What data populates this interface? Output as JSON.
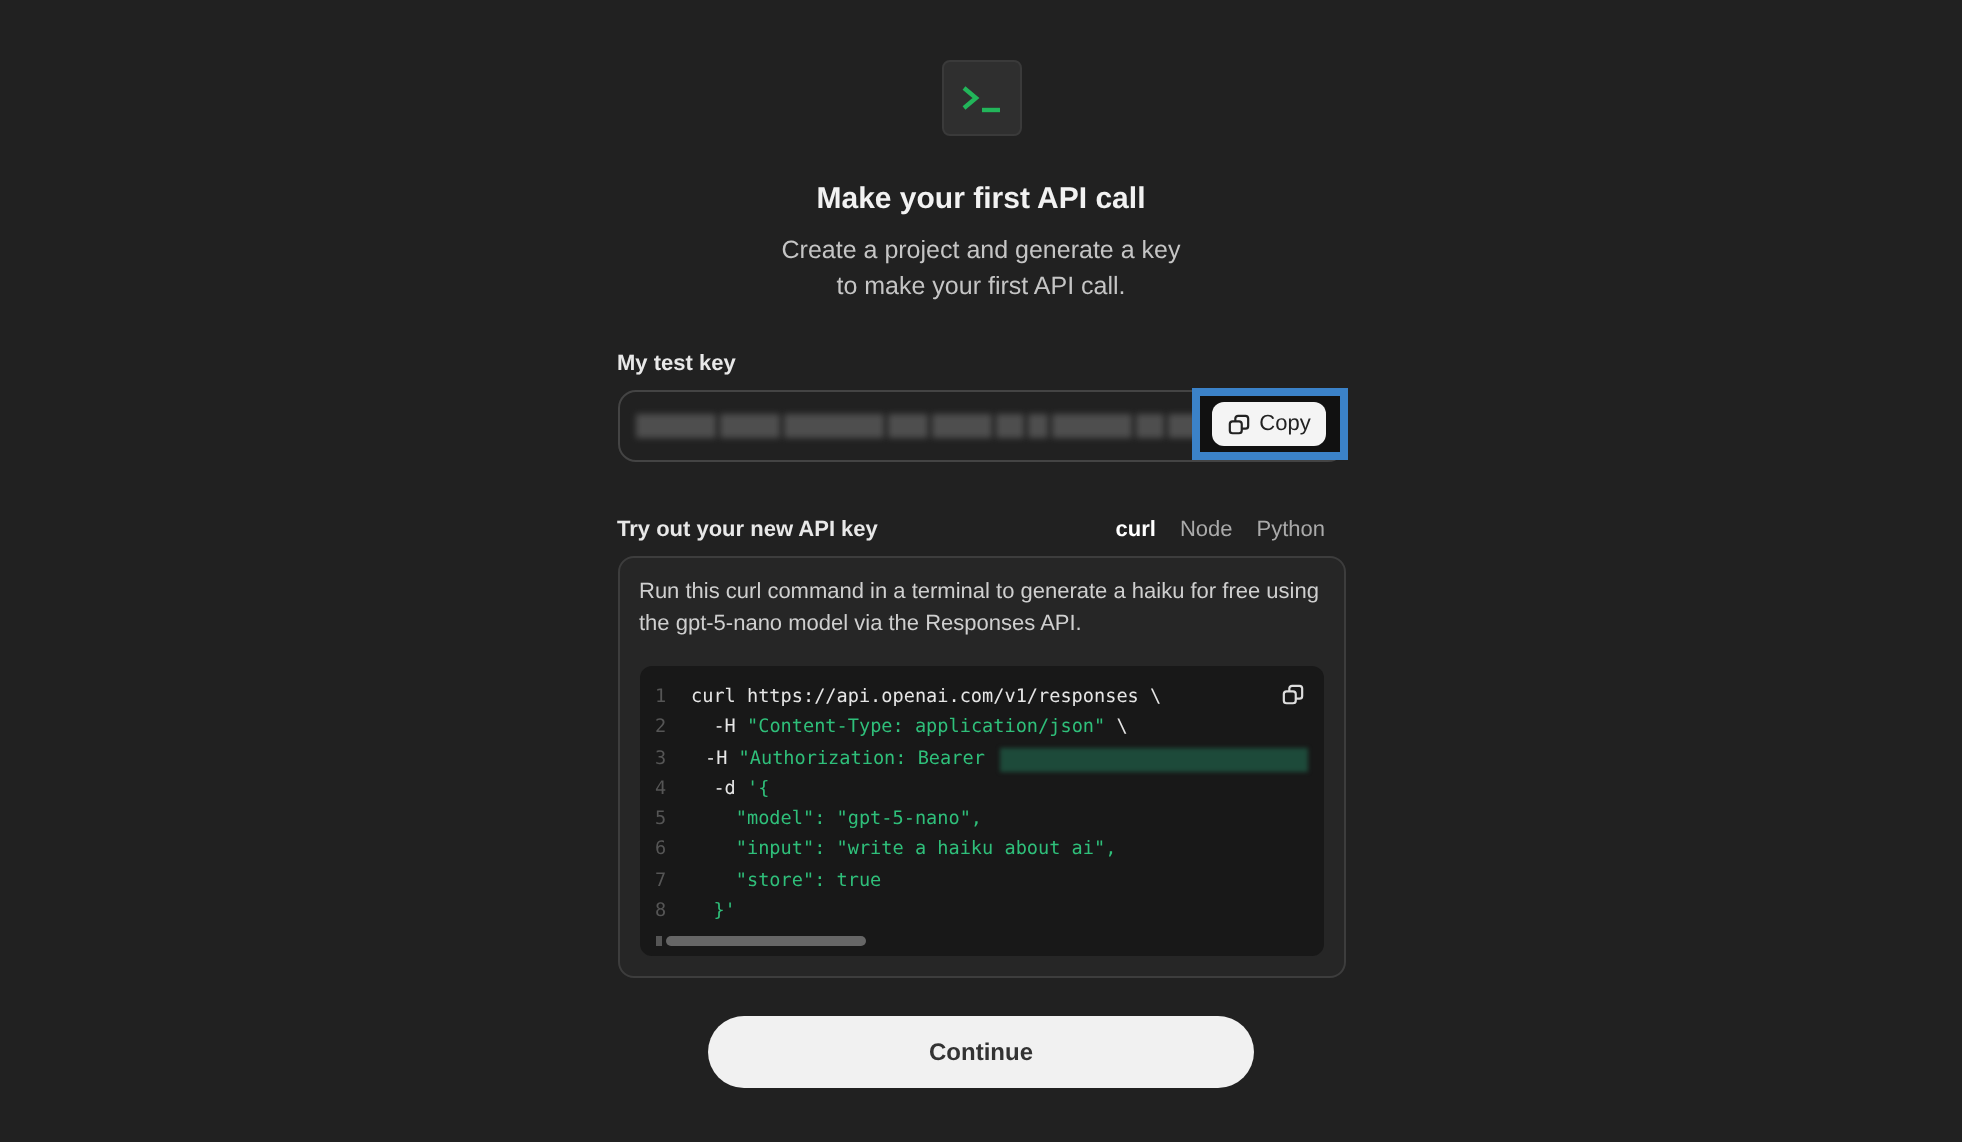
{
  "header": {
    "title": "Make your first API call",
    "subtitle": "Create a project and generate a key to make your first API call."
  },
  "key_section": {
    "label": "My test key",
    "field": {
      "kind": "masked"
    },
    "copy_button": {
      "label": "Copy",
      "highlighted": true
    }
  },
  "try_section": {
    "label": "Try out your new API key",
    "tabs": [
      {
        "label": "curl",
        "selected": true
      },
      {
        "label": "Node",
        "selected": false
      },
      {
        "label": "Python",
        "selected": false
      }
    ],
    "description": "Run this curl command in a terminal to generate a haiku for free using the gpt-5-nano model via the Responses API.",
    "code_lines": [
      {
        "number": "1",
        "tokens": [
          {
            "kind": "plain",
            "text": "curl https://api.openai.com/v1/responses \\"
          }
        ]
      },
      {
        "number": "2",
        "tokens": [
          {
            "kind": "plain",
            "text": "  -H "
          },
          {
            "kind": "string",
            "text": "\"Content-Type: application/json\""
          },
          {
            "kind": "plain",
            "text": " \\"
          }
        ]
      },
      {
        "number": "3",
        "tokens": [
          {
            "kind": "plain",
            "text": "  -H "
          },
          {
            "kind": "string",
            "text": "\"Authorization: Bearer"
          },
          {
            "kind": "masked"
          }
        ]
      },
      {
        "number": "4",
        "tokens": [
          {
            "kind": "plain",
            "text": "  -d "
          },
          {
            "kind": "string",
            "text": "'{"
          }
        ]
      },
      {
        "number": "5",
        "tokens": [
          {
            "kind": "string",
            "text": "    \"model\": \"gpt-5-nano\","
          }
        ]
      },
      {
        "number": "6",
        "tokens": [
          {
            "kind": "string",
            "text": "    \"input\": \"write a haiku about ai\","
          }
        ]
      },
      {
        "number": "7",
        "tokens": [
          {
            "kind": "string",
            "text": "    \"store\": true"
          }
        ]
      },
      {
        "number": "8",
        "tokens": [
          {
            "kind": "string",
            "text": "  }'"
          }
        ]
      }
    ]
  },
  "continue_button": {
    "label": "Continue"
  }
}
